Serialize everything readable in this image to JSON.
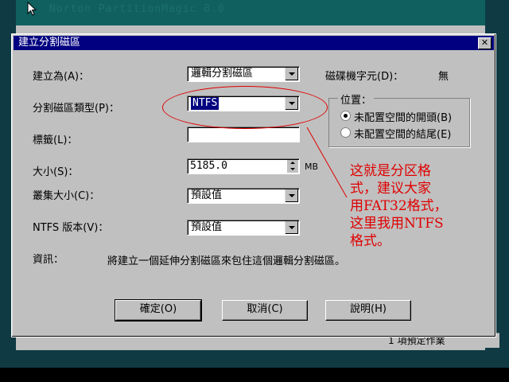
{
  "background_window": {
    "title": "Norton PartitionMagic 8.0",
    "status_text": "1 項預定作業"
  },
  "dialog": {
    "title": "建立分割磁區",
    "fields": {
      "create_as_label": "建立為(A)：",
      "create_as_value": "邏輯分割磁區",
      "drive_letter_label": "磁碟機字元(D)：",
      "drive_letter_value": "無",
      "partition_type_label": "分割磁區類型(P)：",
      "partition_type_value": "NTFS",
      "label_label": "標籤(L)：",
      "label_value": "",
      "size_label": "大小(S)：",
      "size_value": "5185.0",
      "size_unit": "MB",
      "cluster_label": "叢集大小(C)：",
      "cluster_value": "預設值",
      "ntfs_version_label": "NTFS 版本(V)：",
      "ntfs_version_value": "預設值",
      "info_label": "資訊：",
      "info_text": "將建立一個延伸分割磁區來包住這個邏輯分割磁區。"
    },
    "position_group": {
      "title": "位置：",
      "options": [
        {
          "label": "未配置空間的開頭(B)",
          "selected": true
        },
        {
          "label": "未配置空間的結尾(E)",
          "selected": false
        }
      ]
    },
    "buttons": {
      "ok": "確定(O)",
      "cancel": "取消(C)",
      "help": "說明(H)"
    }
  },
  "annotation": {
    "line1": "这就是分区格",
    "line2": "式，建议大家",
    "line3": "用FAT32格式，",
    "line4": "这里我用NTFS",
    "line5": "格式。",
    "color": "#e00000"
  }
}
